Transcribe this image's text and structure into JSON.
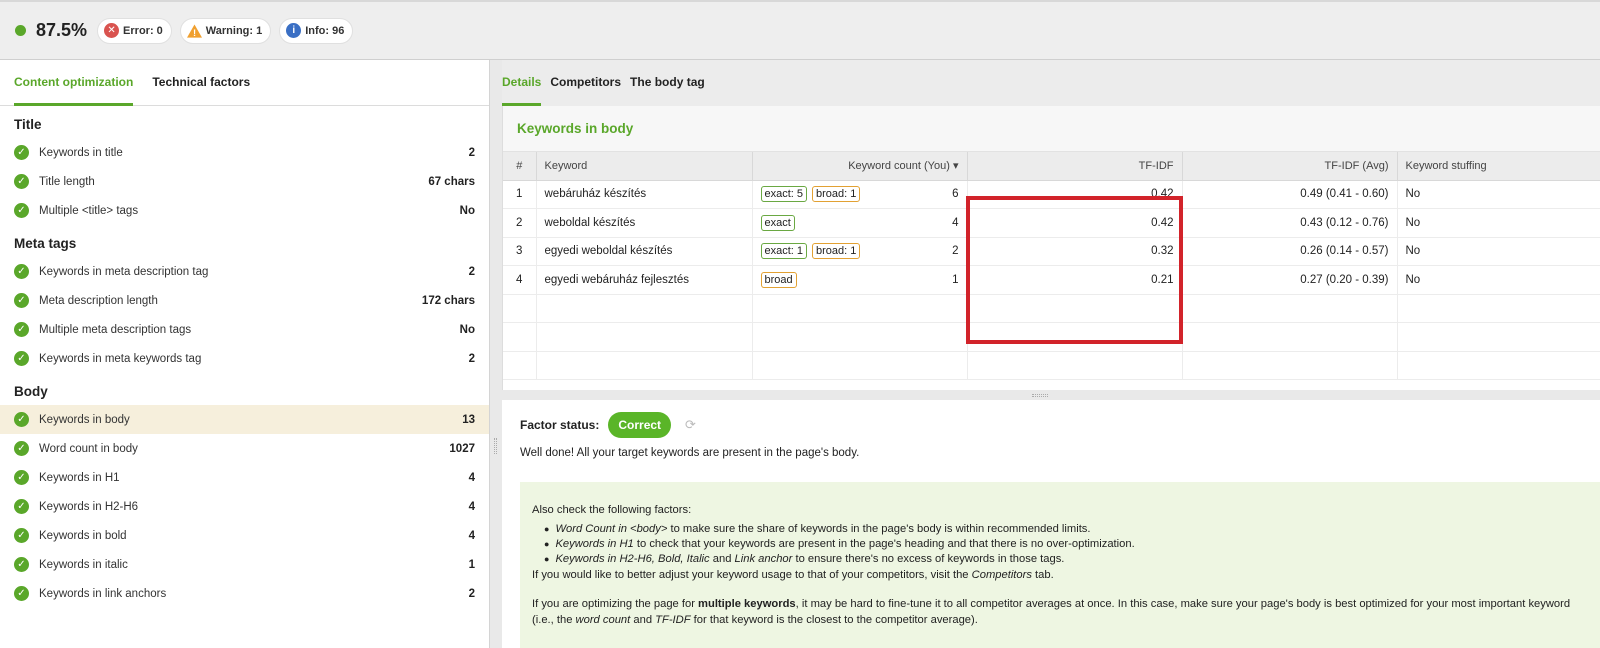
{
  "topbar": {
    "score": "87.5%",
    "error_label": "Error: 0",
    "warning_label": "Warning: 1",
    "info_label": "Info: 96",
    "colors": {
      "score_dot": "#5aa72a",
      "error": "#d9534f",
      "warning": "#f0a030",
      "info": "#3a6fc4"
    }
  },
  "left": {
    "tabs": [
      "Content optimization",
      "Technical factors"
    ],
    "sections": [
      {
        "title": "Title",
        "items": [
          {
            "label": "Keywords in title",
            "value": "2"
          },
          {
            "label": "Title length",
            "value": "67 chars"
          },
          {
            "label": "Multiple <title> tags",
            "value": "No"
          }
        ]
      },
      {
        "title": "Meta tags",
        "items": [
          {
            "label": "Keywords in meta description tag",
            "value": "2"
          },
          {
            "label": "Meta description length",
            "value": "172 chars"
          },
          {
            "label": "Multiple meta description tags",
            "value": "No"
          },
          {
            "label": "Keywords in meta keywords tag",
            "value": "2"
          }
        ]
      },
      {
        "title": "Body",
        "items": [
          {
            "label": "Keywords in body",
            "value": "13"
          },
          {
            "label": "Word count in body",
            "value": "1027"
          },
          {
            "label": "Keywords in H1",
            "value": "4"
          },
          {
            "label": "Keywords in H2-H6",
            "value": "4"
          },
          {
            "label": "Keywords in bold",
            "value": "4"
          },
          {
            "label": "Keywords in italic",
            "value": "1"
          },
          {
            "label": "Keywords in link anchors",
            "value": "2"
          }
        ]
      }
    ]
  },
  "right": {
    "tabs": [
      "Details",
      "Competitors",
      "The body tag"
    ],
    "panel_title": "Keywords in body",
    "table": {
      "headers": [
        "#",
        "Keyword",
        "Keyword count (You)",
        "TF-IDF",
        "TF-IDF (Avg)",
        "Keyword stuffing"
      ],
      "sort_indicator": "▾",
      "rows": [
        {
          "num": "1",
          "keyword": "webáruház készítés",
          "tags": [
            {
              "text": "exact: 5",
              "kind": "exact"
            },
            {
              "text": "broad: 1",
              "kind": "broad"
            }
          ],
          "count": "6",
          "tfidf": "0.42",
          "avg": "0.49 (0.41 - 0.60)",
          "stuffing": "No"
        },
        {
          "num": "2",
          "keyword": "weboldal készítés",
          "tags": [
            {
              "text": "exact",
              "kind": "exact"
            }
          ],
          "count": "4",
          "tfidf": "0.42",
          "avg": "0.43 (0.12 - 0.76)",
          "stuffing": "No"
        },
        {
          "num": "3",
          "keyword": "egyedi weboldal készítés",
          "tags": [
            {
              "text": "exact: 1",
              "kind": "exact"
            },
            {
              "text": "broad: 1",
              "kind": "broad"
            }
          ],
          "count": "2",
          "tfidf": "0.32",
          "avg": "0.26 (0.14 - 0.57)",
          "stuffing": "No"
        },
        {
          "num": "4",
          "keyword": "egyedi webáruház fejlesztés",
          "tags": [
            {
              "text": "broad",
              "kind": "broad"
            }
          ],
          "count": "1",
          "tfidf": "0.21",
          "avg": "0.27 (0.20 - 0.39)",
          "stuffing": "No"
        }
      ],
      "empty_rows": 3
    },
    "detail": {
      "status_label": "Factor status:",
      "status_value": "Correct",
      "message": "Well done! All your target keywords are present in the page's body.",
      "also_check": "Also check the following factors:",
      "bullets": [
        {
          "em": "Word Count in <body>",
          "rest": " to make sure the share of keywords in the page's body is within recommended limits."
        },
        {
          "em": "Keywords in H1",
          "rest": " to check that your keywords are present in the page's heading and that there is no over-optimization."
        },
        {
          "em": "Keywords in H2-H6, Bold, Italic",
          "mid": " and ",
          "em2": "Link anchor",
          "rest": " to ensure there's no excess of keywords in those tags."
        }
      ],
      "competitors_line_pre": "If you would like to better adjust your keyword usage to that of your competitors, visit the ",
      "competitors_line_em": "Competitors",
      "competitors_line_post": " tab.",
      "multi_pre": "If you are optimizing the page for ",
      "multi_bold": "multiple keywords",
      "multi_mid": ", it may be hard to fine-tune it to all competitor averages at once. In this case, make sure your page's body is best optimized for your most important keyword (i.e., the ",
      "multi_em1": "word count",
      "multi_and": " and ",
      "multi_em2": "TF-IDF",
      "multi_post": " for that keyword is the closest to the competitor average)."
    }
  }
}
